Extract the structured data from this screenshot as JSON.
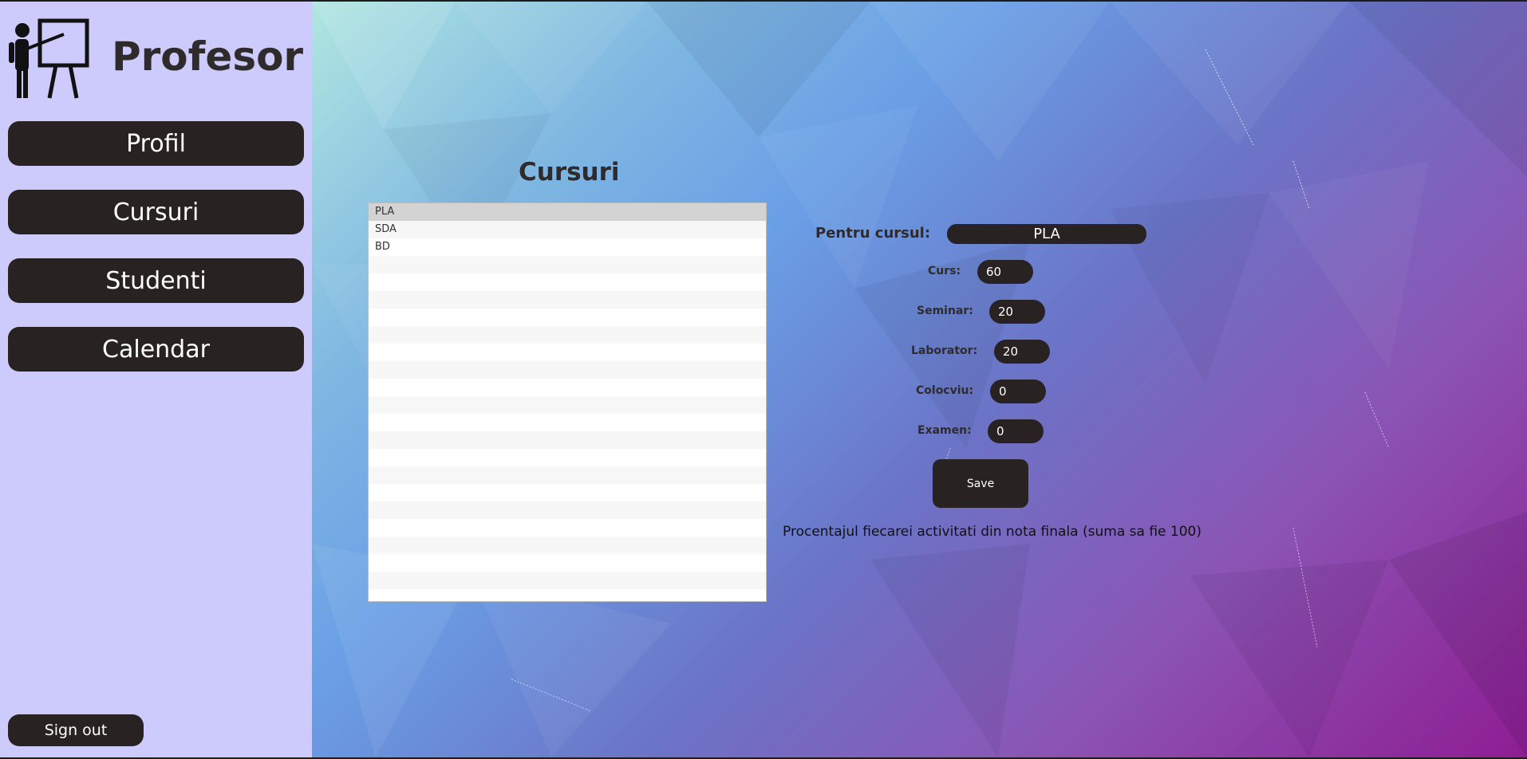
{
  "app": {
    "title": "Profesor"
  },
  "nav": {
    "items": [
      {
        "label": "Profil"
      },
      {
        "label": "Cursuri"
      },
      {
        "label": "Studenti"
      },
      {
        "label": "Calendar"
      }
    ],
    "signout_label": "Sign out"
  },
  "main": {
    "title": "Cursuri",
    "courses": [
      "PLA",
      "SDA",
      "BD"
    ],
    "selected_course_index": 0
  },
  "form": {
    "course_label": "Pentru cursul:",
    "course_value": "PLA",
    "curs_label": "Curs:",
    "curs_value": "60",
    "seminar_label": "Seminar:",
    "seminar_value": "20",
    "laborator_label": "Laborator:",
    "laborator_value": "20",
    "colocviu_label": "Colocviu:",
    "colocviu_value": "0",
    "examen_label": "Examen:",
    "examen_value": "0",
    "save_label": "Save",
    "hint": "Procentajul fiecarei activitati din nota finala (suma sa fie 100)"
  },
  "colors": {
    "sidebar_bg": "#cccbfc",
    "button_bg": "#282222",
    "title_text": "#2f2b2c"
  },
  "icons": {
    "logo": "teacher-board-icon"
  }
}
